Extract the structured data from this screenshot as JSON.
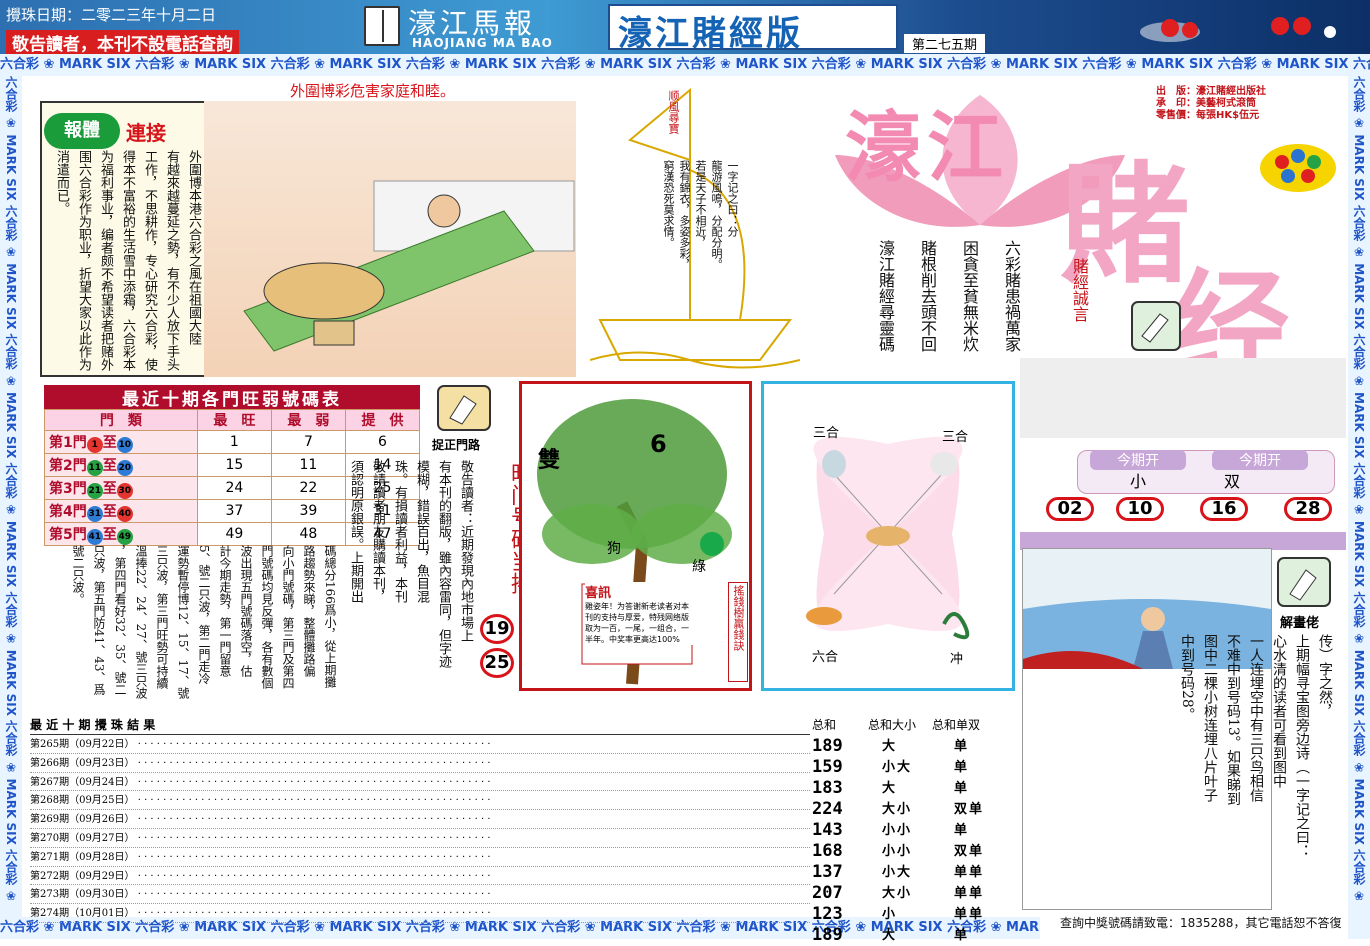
{
  "header": {
    "date": "攪珠日期：二零二三年十月二日",
    "notice": "敬告讀者，本刊不設電話查詢",
    "paper_name": "濠江馬報",
    "paper_en": "HAOJIANG MA BAO",
    "edition": "濠江賭經版",
    "issue": "第二七五期"
  },
  "border_text": "六合彩 ❀ MARK SIX",
  "publisher": {
    "line1": "出　版：濠江賭經出版社",
    "line2": "承　印：美藝柯式滾筒",
    "line3": "零售價：每張HK$伍元"
  },
  "logo": {
    "text1": "濠江",
    "text2": "賭",
    "text3": "经"
  },
  "motto_label": "賭經誠言",
  "motto_cols": [
    "六彩賭患禍萬家",
    "困貪至貧無米炊",
    "賭根削去頭不回",
    "濠江賭經尋靈碼"
  ],
  "comic": {
    "caption": "外圍博彩危害家庭和睦。",
    "badge": "報體",
    "badge_red": "連接",
    "text_cols": [
      "外圍博本港六合彩之風在祖國大陸",
      "有越來越蔓延之勢，有不少人放下手头",
      "工作，不思耕作，专心研究六合彩，使",
      "得本不富裕的生活雪中添霜，六合彩本",
      "为福利事业，编者颇不希望读者把赌外",
      "围六合彩作为职业，折望大家以此作为",
      "消遣而已。"
    ]
  },
  "boat": {
    "sail_text": "顺風尋寶",
    "poem_cols": [
      "一字记之曰：分",
      "龍游風鳴，分配分明。",
      "若是天子不相近，",
      "我有錦衣，多姿多彩，",
      "窮漢恐死莫求情。"
    ]
  },
  "table": {
    "title": "最近十期各門旺弱號碼表",
    "headers": [
      "門　類",
      "最　旺",
      "最　弱",
      "提　供"
    ],
    "rows": [
      {
        "gate": "第1門",
        "from": "1",
        "to": "10",
        "fc": "#e3342f",
        "tc": "#2d7bd5",
        "max": "1",
        "min": "7",
        "give": "6"
      },
      {
        "gate": "第2門",
        "from": "11",
        "to": "20",
        "fc": "#25a244",
        "tc": "#2d7bd5",
        "max": "15",
        "min": "11",
        "give": "14"
      },
      {
        "gate": "第3門",
        "from": "21",
        "to": "30",
        "fc": "#25a244",
        "tc": "#e3342f",
        "max": "24",
        "min": "22",
        "give": "25"
      },
      {
        "gate": "第4門",
        "from": "31",
        "to": "40",
        "fc": "#2d7bd5",
        "tc": "#e3342f",
        "max": "37",
        "min": "39",
        "give": "31"
      },
      {
        "gate": "第5門",
        "from": "41",
        "to": "49",
        "fc": "#2d7bd5",
        "tc": "#25a244",
        "max": "49",
        "min": "48",
        "give": "47"
      }
    ],
    "to_char": "至"
  },
  "gate_tip": {
    "icon_label": "捉正門路",
    "label": "旺门号码当捧",
    "nums": [
      "19",
      "25"
    ]
  },
  "articles": {
    "notice_cols": [
      "敬告讀者：近期發現內地市場上",
      "有本刊的翻版，雖內容雷同，但字迹",
      "模糊，錯誤百出，魚目混",
      "珠。有損讀者利益，本刊",
      "敬請讀者朋友購讀本刊，",
      "須認明原銀誤。上期開出"
    ],
    "trend_cols": [
      "碼總分166爲小，從上期攤",
      "路趨勢來睇，整體攤路偏",
      "向小門號碼，第三門及第四",
      "門號碼均見反彈，各有數個",
      "波出現五門號碼落空，估",
      "計今期走勢，第一門留意",
      "5、號二只波，第二門走冷",
      "運勢暫停博12、15、17、號",
      "三只波，第三門旺勢可持續",
      "溫捧22、24、27、號三只波",
      "，第四門看好32、35、號二",
      "只波，第五門防41、43、爲",
      "號二只波。"
    ]
  },
  "tree": {
    "pair": "雙",
    "num": "6",
    "dog": "狗",
    "green": "綠",
    "news_title": "喜訊",
    "news_text": "雞姿年！为答谢新老读者对本刊的支持与厚爱，特残网络版取为一百，一尾，一组合，一半年。中奖率更高达100%",
    "side": "搖錢樹贏錢訣"
  },
  "cross": {
    "tl": "三合",
    "tr": "三合",
    "bl": "六合",
    "br": "冲"
  },
  "results": {
    "label": "今期开",
    "size": "小",
    "parity": "双",
    "numbers": [
      "02",
      "10",
      "16",
      "28"
    ]
  },
  "explain": {
    "icon_label": "解畫佬",
    "cols": [
      "传）字之然，",
      "上期幅寻宝图旁边诗（一字记之曰：",
      "心水清的读者可看到图中",
      "一人连埋空中有三只鸟相信",
      "不难中到号码13。如果睇到",
      "图中二棵小树连埋八片叶子",
      "中到号码28。"
    ]
  },
  "history": {
    "title": "最 近 十 期 攪 珠 結 果",
    "rows": [
      "第265期（09月22日）",
      "第266期（09月23日）",
      "第267期（09月24日）",
      "第268期（09月25日）",
      "第269期（09月26日）",
      "第270期（09月27日）",
      "第271期（09月28日）",
      "第272期（09月29日）",
      "第273期（09月30日）",
      "第274期（10月01日）"
    ]
  },
  "summary": {
    "headers": [
      "总和",
      "总和大小",
      "总和单双"
    ],
    "sums": [
      "189",
      "159",
      "183",
      "224",
      "143",
      "168",
      "137",
      "207",
      "123",
      "189"
    ],
    "size": [
      "大",
      "小大",
      "大",
      "大小",
      "小小",
      "小小",
      "小大",
      "大小",
      "小",
      "大"
    ],
    "parity": [
      "单",
      "单",
      "单",
      "双单",
      "单",
      "双单",
      "单单",
      "单单",
      "单单",
      "单"
    ]
  },
  "footer": "查詢中獎號碼請致電：1835288，其它電話恕不答復"
}
